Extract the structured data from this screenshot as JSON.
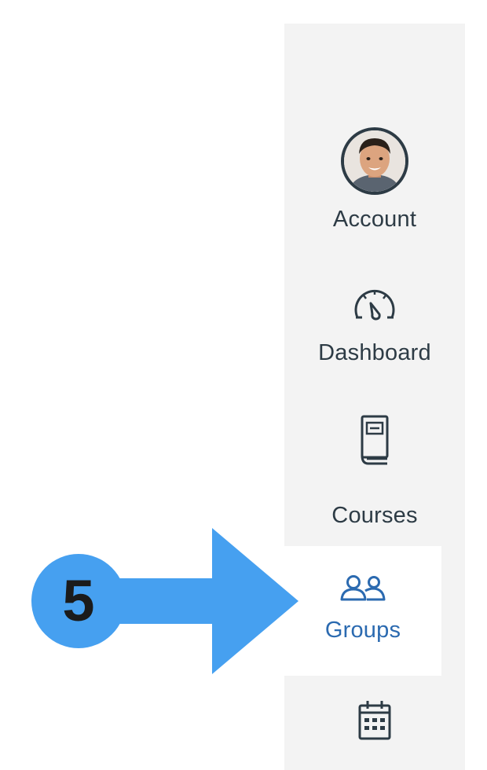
{
  "nav": {
    "items": [
      {
        "label": "Account",
        "icon": "account-avatar"
      },
      {
        "label": "Dashboard",
        "icon": "dashboard-icon"
      },
      {
        "label": "Courses",
        "icon": "courses-icon"
      },
      {
        "label": "Groups",
        "icon": "groups-icon",
        "active": true
      },
      {
        "label": "",
        "icon": "calendar-icon"
      }
    ],
    "colors": {
      "background": "#f3f3f3",
      "text": "#2d3b45",
      "active_text": "#2b6ab0"
    }
  },
  "callout": {
    "step": "5",
    "color": "#46a0f0",
    "target": "Groups"
  }
}
